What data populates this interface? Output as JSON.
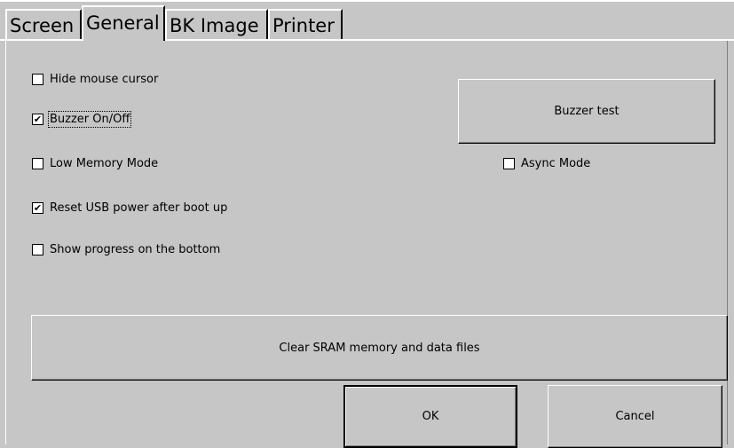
{
  "tabs": [
    {
      "label": "Screen",
      "active": false
    },
    {
      "label": "General",
      "active": true
    },
    {
      "label": "BK Image",
      "active": false
    },
    {
      "label": "Printer",
      "active": false
    }
  ],
  "options": {
    "hide_mouse_cursor": {
      "label": "Hide mouse cursor",
      "checked": false
    },
    "buzzer_on_off": {
      "label": "Buzzer On/Off",
      "checked": true
    },
    "low_memory_mode": {
      "label": "Low Memory Mode",
      "checked": false
    },
    "async_mode": {
      "label": "Async Mode",
      "checked": false
    },
    "reset_usb_power": {
      "label": "Reset USB power after boot up",
      "checked": true
    },
    "show_progress": {
      "label": "Show progress on the bottom",
      "checked": false
    }
  },
  "buttons": {
    "buzzer_test": "Buzzer test",
    "clear_sram": "Clear SRAM memory and data files",
    "ok": "OK",
    "cancel": "Cancel"
  },
  "check_glyph": "✔"
}
